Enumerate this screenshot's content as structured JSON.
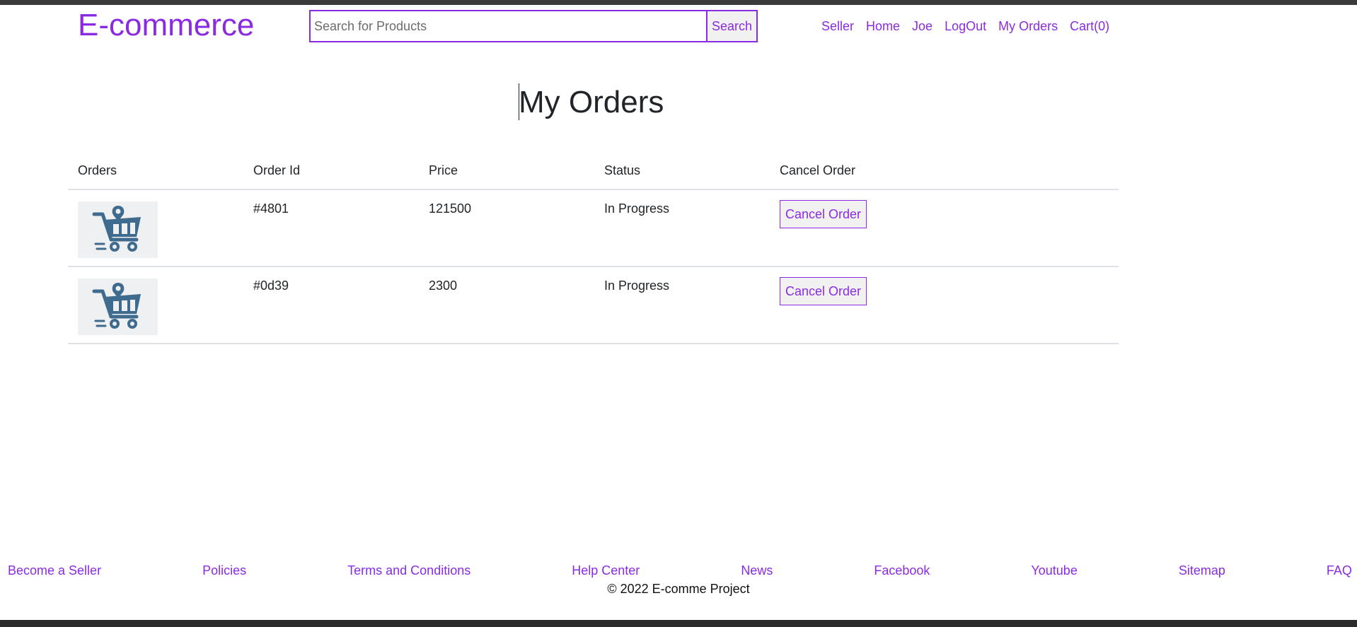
{
  "header": {
    "brand": "E-commerce",
    "search": {
      "placeholder": "Search for Products",
      "value": "",
      "button_label": "Search"
    },
    "nav": [
      "Seller",
      "Home",
      "Joe",
      "LogOut",
      "My Orders",
      "Cart(0)"
    ]
  },
  "main": {
    "title": "My Orders",
    "table": {
      "headers": [
        "Orders",
        "Order Id",
        "Price",
        "Status",
        "Cancel Order"
      ],
      "rows": [
        {
          "order_id": "#4801",
          "price": "121500",
          "status": "In Progress",
          "action_label": "Cancel Order"
        },
        {
          "order_id": "#0d39",
          "price": "2300",
          "status": "In Progress",
          "action_label": "Cancel Order"
        }
      ]
    }
  },
  "footer": {
    "links": [
      "Become a Seller",
      "Policies",
      "Terms and Conditions",
      "Help Center",
      "News",
      "Facebook",
      "Youtube",
      "Sitemap",
      "FAQ"
    ],
    "copyright": "© 2022 E-comme Project"
  },
  "colors": {
    "accent": "#8a2be2",
    "cart_icon": "#3f6b8f",
    "divider": "#dee2e6"
  }
}
